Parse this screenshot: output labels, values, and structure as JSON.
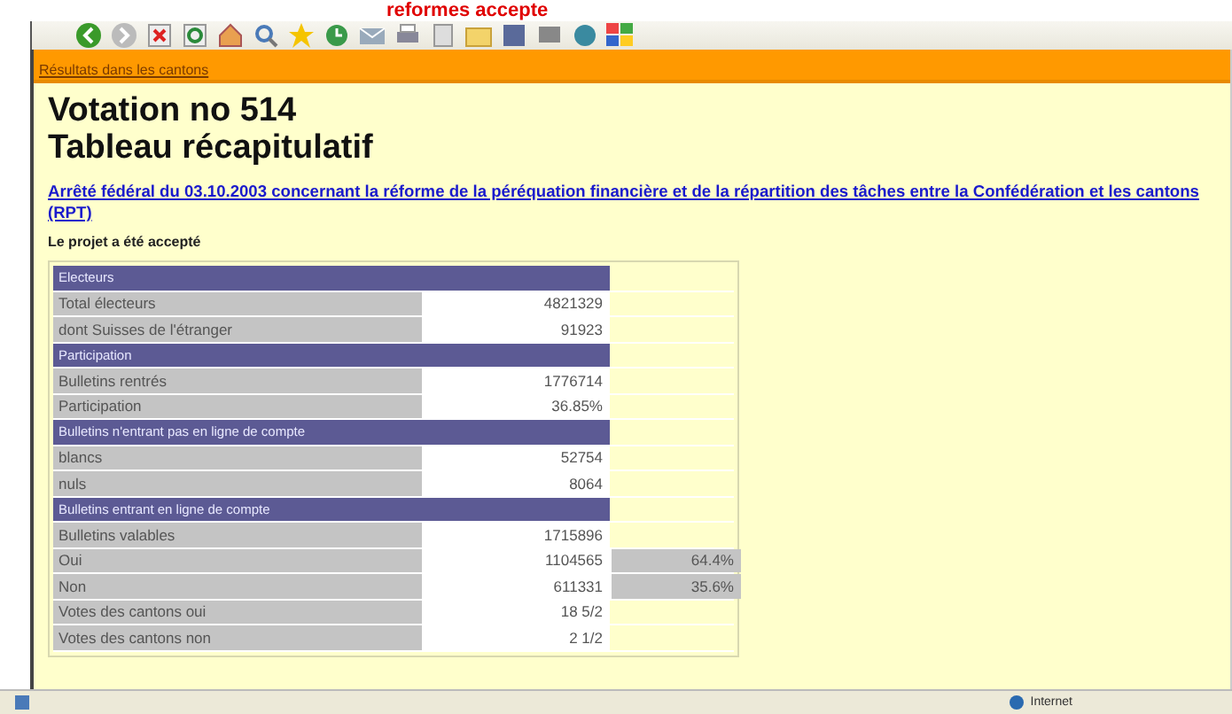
{
  "banner_title": "reformes accepte",
  "toolbar": {
    "status": "Internet"
  },
  "nav": {
    "link": "Résultats dans les cantons"
  },
  "page": {
    "title": "Votation no 514",
    "subtitle": "Tableau récapitulatif",
    "subject_link": "Arrêté fédéral du 03.10.2003 concernant la réforme de la péréquation financière et de la répartition des tâches entre la Confédération et les cantons (RPT)",
    "outcome": "Le projet a été accepté"
  },
  "table": {
    "sections": [
      {
        "heading": "Electeurs",
        "rows": [
          {
            "label": "Total électeurs",
            "value": "4821329"
          },
          {
            "label": "dont Suisses de l'étranger",
            "value": "91923"
          }
        ]
      },
      {
        "heading": "Participation",
        "rows": [
          {
            "label": "Bulletins rentrés",
            "value": "1776714"
          },
          {
            "label": "Participation",
            "value": "36.85%"
          }
        ]
      },
      {
        "heading": "Bulletins n'entrant pas en ligne de compte",
        "rows": [
          {
            "label": "blancs",
            "value": "52754"
          },
          {
            "label": "nuls",
            "value": "8064"
          }
        ]
      },
      {
        "heading": "Bulletins entrant en ligne de compte",
        "rows": [
          {
            "label": "Bulletins valables",
            "value": "1715896"
          },
          {
            "label": "Oui",
            "value": "1104565",
            "percent": "64.4%"
          },
          {
            "label": "Non",
            "value": "611331",
            "percent": "35.6%"
          },
          {
            "label": "Votes des cantons oui",
            "value": "18 5/2"
          },
          {
            "label": "Votes des cantons non",
            "value": "2 1/2"
          }
        ]
      }
    ]
  }
}
